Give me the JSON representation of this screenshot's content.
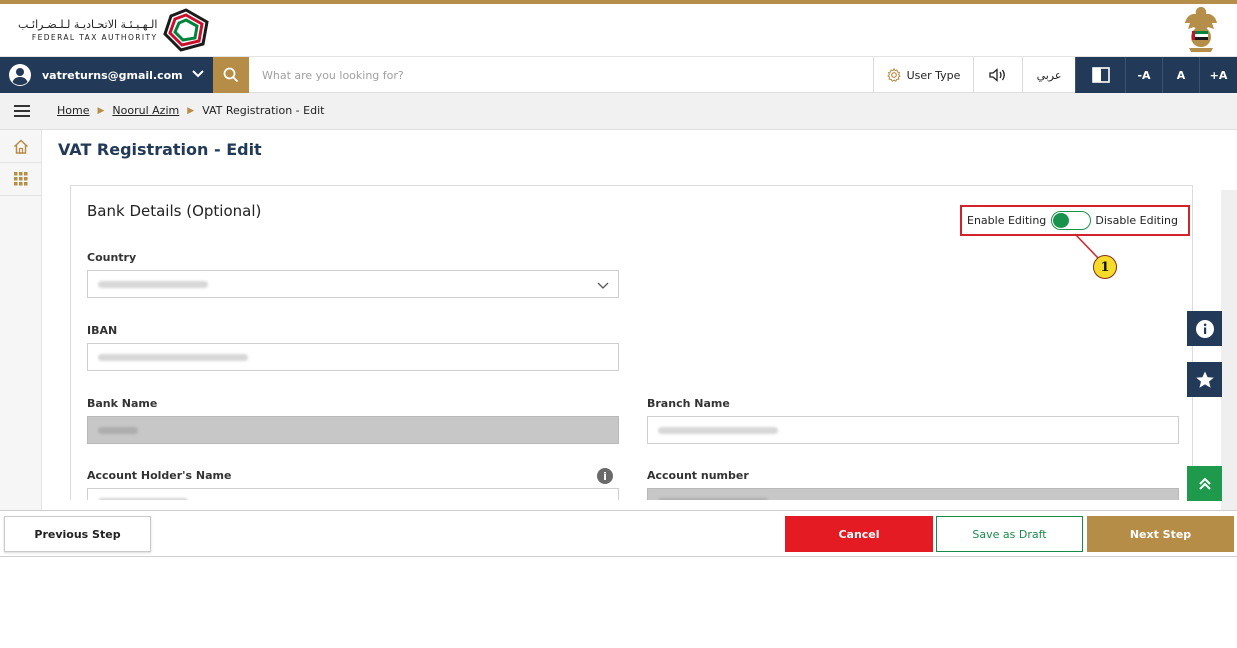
{
  "header": {
    "logo_arabic": "الـهـيـئـة الاتحـاديـة لـلـضـرائـب",
    "logo_english": "FEDERAL TAX AUTHORITY",
    "logo_icon": "fta-logo-icon",
    "emblem_icon": "uae-emblem-icon"
  },
  "navbar": {
    "user_email": "vatreturns@gmail.com",
    "search_placeholder": "What are you looking for?",
    "user_type_label": "User Type",
    "arabic_label": "عربي",
    "font_decrease_label": "-A",
    "font_reset_label": "A",
    "font_increase_label": "+A"
  },
  "breadcrumb": {
    "items": [
      "Home",
      "Noorul Azim",
      "VAT Registration - Edit"
    ]
  },
  "page": {
    "title": "VAT Registration - Edit"
  },
  "section": {
    "title": "Bank Details (Optional)",
    "toggle": {
      "enable_label": "Enable Editing",
      "disable_label": "Disable Editing",
      "state": "enabled"
    },
    "fields": {
      "country_label": "Country",
      "iban_label": "IBAN",
      "bank_name_label": "Bank Name",
      "branch_name_label": "Branch Name",
      "account_holder_label": "Account Holder's Name",
      "account_number_label": "Account number"
    }
  },
  "annotation": {
    "number": "1"
  },
  "footer": {
    "previous_label": "Previous Step",
    "cancel_label": "Cancel",
    "draft_label": "Save as Draft",
    "next_label": "Next Step"
  },
  "colors": {
    "navy": "#223a57",
    "gold": "#b68d47",
    "red": "#e41b23",
    "green": "#19934b"
  }
}
